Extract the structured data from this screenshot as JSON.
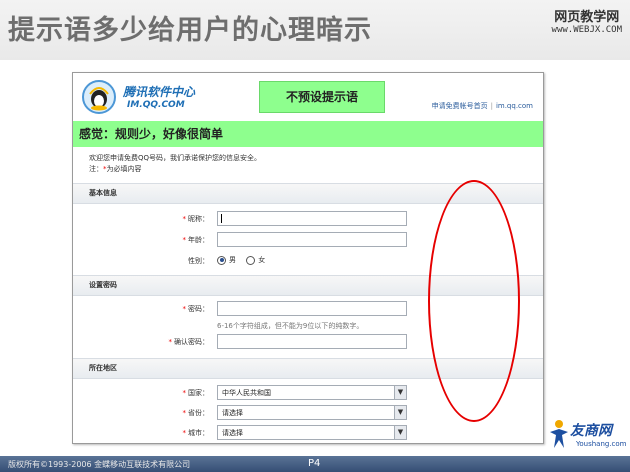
{
  "slide": {
    "title": "提示语多少给用户的心理暗示",
    "watermark_cn": "网页教学网",
    "watermark_url": "www.WEBJX.COM",
    "page_number": "P4",
    "copyright": "版权所有©1993-2006  金蝶移动互联技术有限公司",
    "brand_cn": "友商网",
    "brand_en": "Youshang.com"
  },
  "screenshot": {
    "logo_line1": "腾讯软件中心",
    "logo_line2": "IM.QQ.COM",
    "callout_top": "不预设提示语",
    "top_link_apply": "申请免费帐号首页",
    "top_link_site": "im.qq.com",
    "callout_band": "感觉：规则少，好像很简单",
    "welcome_line1": "欢迎您申请免费QQ号码，我们承诺保护您的信息安全。",
    "required_note_prefix": "注：",
    "required_note_star": "*",
    "required_note_text": "为必填内容",
    "sections": {
      "basic": "基本信息",
      "password": "设置密码",
      "region": "所在地区"
    },
    "fields": {
      "nickname_label": "昵称：",
      "age_label": "年龄：",
      "gender_label": "性别：",
      "gender_male": "男",
      "gender_female": "女",
      "password_label": "密码：",
      "password_hint": "6-16个字符组成，但不能为9位以下的纯数字。",
      "confirm_label": "确认密码：",
      "country_label": "国家：",
      "country_value": "中华人民共和国",
      "province_label": "省份：",
      "province_value": "请选择",
      "city_label": "城市：",
      "city_value": "请选择",
      "required_star": "*"
    }
  },
  "colors": {
    "callout_green": "#8eff8e",
    "annotation_red": "#e60000",
    "footer_blue": "#354e74",
    "link_blue": "#2b5d9c"
  }
}
